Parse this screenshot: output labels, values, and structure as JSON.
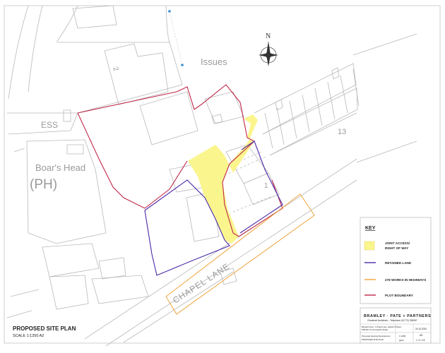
{
  "plan": {
    "labels": {
      "issues": "Issues",
      "ess": "ESS",
      "boars_head": "Boar's Head",
      "ph": "(PH)",
      "house_2": "2",
      "house_13": "13",
      "house_1": "1",
      "chapel_lane": "CHAPEL LANE"
    },
    "north_label": "N"
  },
  "drawing": {
    "title": "PROPOSED SITE PLAN",
    "scale": "SCALE 1:1250 A2"
  },
  "key": {
    "title": "KEY",
    "items": [
      {
        "type": "fill",
        "color": "#fbf58e",
        "label": "JOINT ACCESS/",
        "label2": "RIGHT OF WAY"
      },
      {
        "type": "line",
        "color": "#4b2aa8",
        "label": "RETAINED LAND"
      },
      {
        "type": "line",
        "color": "#f0a33c",
        "label": "278 WORKS IN HIGHWAYS"
      },
      {
        "type": "line",
        "color": "#c0284a",
        "label": "PLOT BOUNDARY"
      }
    ]
  },
  "titleblock": {
    "firm": "BRAMLEY · PATE + PARTNERS",
    "firm_sub": "Chartered Architects  –  Telephone (01772) 335087",
    "project_line1": "Barracks Farm, 1 Chapel Lane, Hoghton Preston",
    "project_line2": "PR5 0RY for De Hoghton Estate",
    "date": "24.10.2020",
    "desc_line1": "Proposed Housing Development",
    "desc_line2": "PROPOSED SITE PLAN",
    "scale_cell": "1:1250",
    "size_cell": "@A2",
    "rev": "AD",
    "number": "1 / 0 / 15"
  },
  "colors": {
    "joint_access": "#fbf58e",
    "retained_land": "#4b2aa8",
    "highway_works": "#f0a33c",
    "plot_boundary": "#c0284a",
    "linework": "#b9b9b9"
  }
}
